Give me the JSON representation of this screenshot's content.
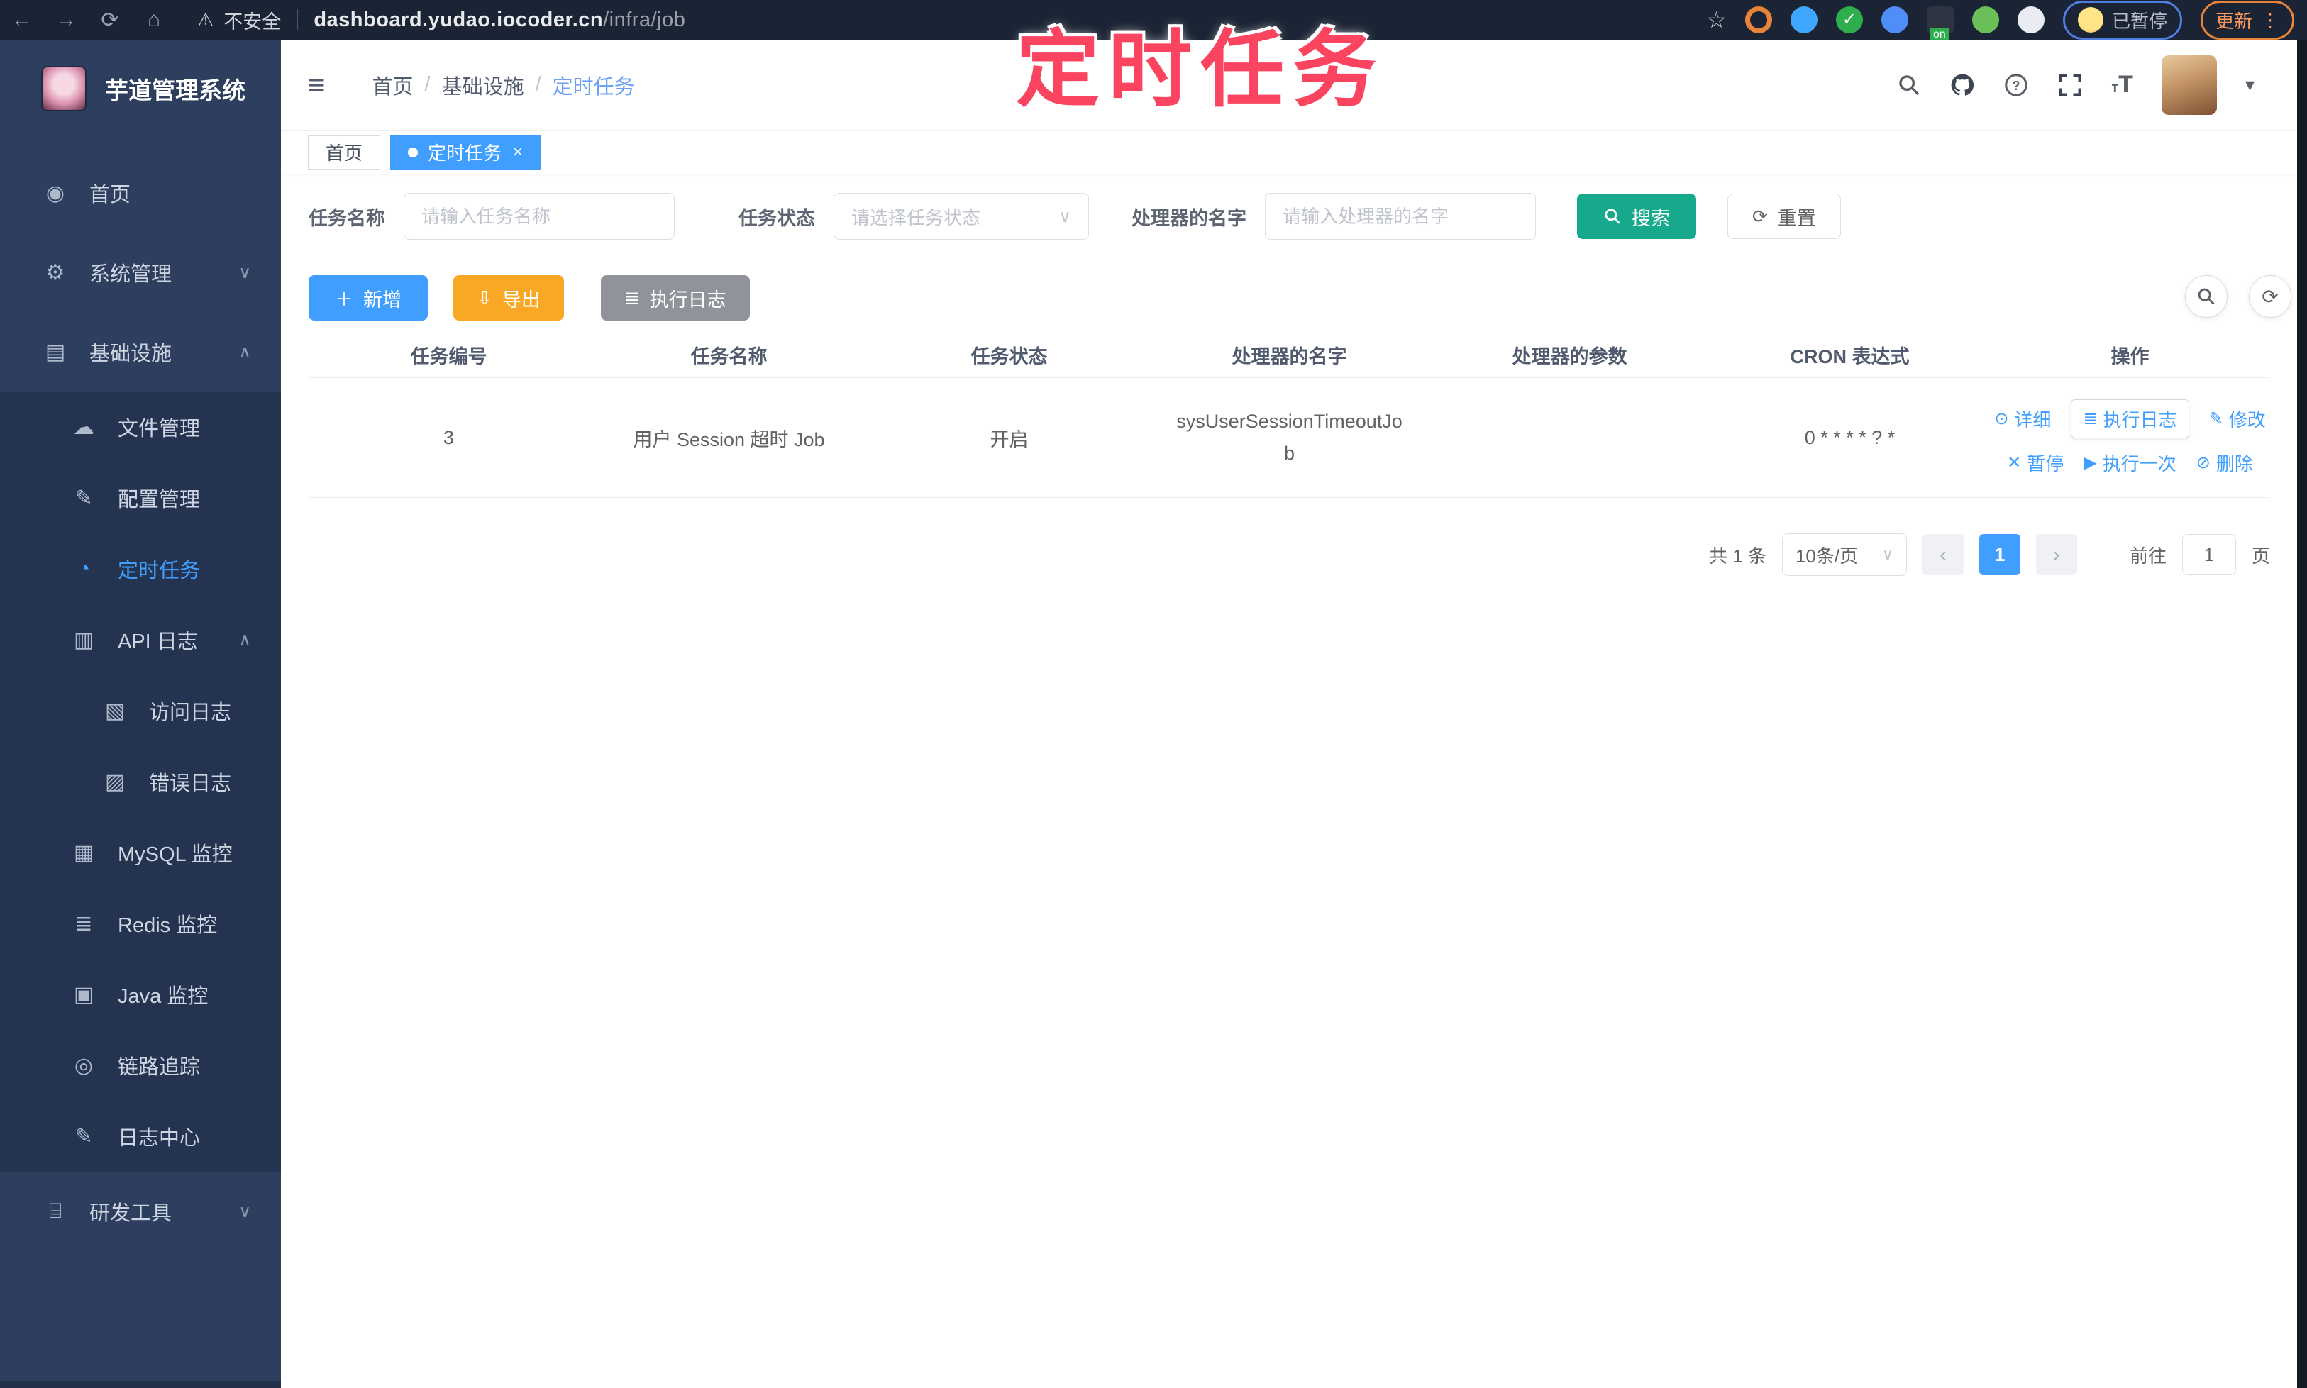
{
  "browser": {
    "security_label": "不安全",
    "url_domain": "dashboard.yudao.iocoder.cn",
    "url_path": "/infra/job",
    "paused_badge": "已暂停",
    "update_button": "更新"
  },
  "overlay": {
    "title": "定时任务"
  },
  "sidebar": {
    "logo_title": "芋道管理系统",
    "items": [
      {
        "label": "首页",
        "icon": "dashboard-icon"
      },
      {
        "label": "系统管理",
        "icon": "gear-icon",
        "chevron": "down"
      },
      {
        "label": "基础设施",
        "icon": "infra-icon",
        "chevron": "up"
      },
      {
        "label": "文件管理",
        "icon": "cloud-upload-icon"
      },
      {
        "label": "配置管理",
        "icon": "config-icon"
      },
      {
        "label": "定时任务",
        "icon": "timer-icon",
        "active": true
      },
      {
        "label": "API 日志",
        "icon": "api-log-icon",
        "chevron": "up"
      },
      {
        "label": "访问日志",
        "icon": "access-log-icon"
      },
      {
        "label": "错误日志",
        "icon": "error-log-icon"
      },
      {
        "label": "MySQL 监控",
        "icon": "mysql-icon"
      },
      {
        "label": "Redis 监控",
        "icon": "redis-icon"
      },
      {
        "label": "Java 监控",
        "icon": "java-icon"
      },
      {
        "label": "链路追踪",
        "icon": "trace-icon"
      },
      {
        "label": "日志中心",
        "icon": "log-center-icon"
      },
      {
        "label": "研发工具",
        "icon": "devtools-icon",
        "chevron": "down"
      }
    ]
  },
  "header": {
    "breadcrumb": [
      "首页",
      "基础设施",
      "定时任务"
    ],
    "breadcrumb_separator": "/"
  },
  "tabs": [
    {
      "label": "首页"
    },
    {
      "label": "定时任务",
      "active": true
    }
  ],
  "filters": {
    "job_name_label": "任务名称",
    "job_name_placeholder": "请输入任务名称",
    "job_status_label": "任务状态",
    "job_status_placeholder": "请选择任务状态",
    "handler_label": "处理器的名字",
    "handler_placeholder": "请输入处理器的名字",
    "search_label": "搜索",
    "reset_label": "重置"
  },
  "toolbar": {
    "add_label": "新增",
    "export_label": "导出",
    "run_log_label": "执行日志"
  },
  "table": {
    "columns": [
      "任务编号",
      "任务名称",
      "任务状态",
      "处理器的名字",
      "处理器的参数",
      "CRON 表达式",
      "操作"
    ],
    "row": {
      "id": "3",
      "name": "用户 Session 超时 Job",
      "status": "开启",
      "handler": "sysUserSessionTimeoutJob",
      "param": "",
      "cron": "0 * * * * ? *"
    },
    "actions_row1": [
      "详细",
      "执行日志",
      "修改"
    ],
    "actions_row2": [
      "暂停",
      "执行一次",
      "删除"
    ]
  },
  "pagination": {
    "total": "共 1 条",
    "page_size": "10条/页",
    "page": "1",
    "goto_label": "前往",
    "goto_value": "1",
    "page_unit": "页"
  },
  "colors": {
    "accent": "#409eff",
    "search_teal": "#17a98c",
    "export_orange": "#f9a825",
    "info_gray": "#909399",
    "sidebar_bg": "#2d3e5e",
    "submenu_bg": "#243450",
    "overlay_pink": "#fb4460"
  }
}
